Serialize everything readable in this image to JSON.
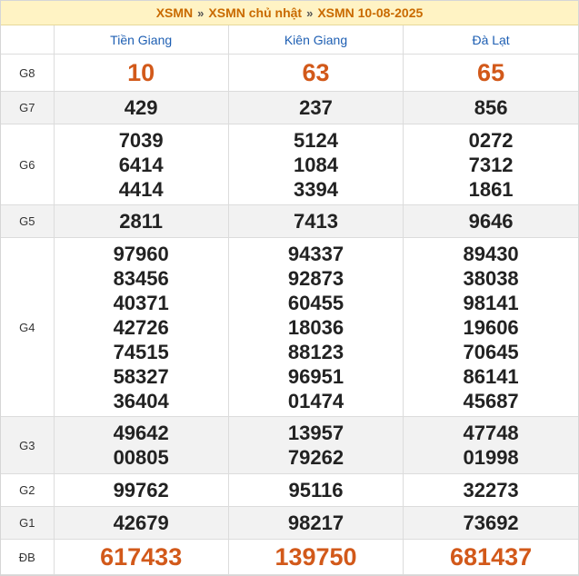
{
  "breadcrumb": {
    "item1": "XSMN",
    "item2": "XSMN chủ nhật",
    "item3": "XSMN 10-08-2025",
    "separator": "»"
  },
  "headers": [
    "Tiền Giang",
    "Kiên Giang",
    "Đà Lạt"
  ],
  "rows": [
    {
      "label": "G8",
      "values": [
        [
          "10"
        ],
        [
          "63"
        ],
        [
          "65"
        ]
      ]
    },
    {
      "label": "G7",
      "values": [
        [
          "429"
        ],
        [
          "237"
        ],
        [
          "856"
        ]
      ]
    },
    {
      "label": "G6",
      "values": [
        [
          "7039",
          "6414",
          "4414"
        ],
        [
          "5124",
          "1084",
          "3394"
        ],
        [
          "0272",
          "7312",
          "1861"
        ]
      ]
    },
    {
      "label": "G5",
      "values": [
        [
          "2811"
        ],
        [
          "7413"
        ],
        [
          "9646"
        ]
      ]
    },
    {
      "label": "G4",
      "values": [
        [
          "97960",
          "83456",
          "40371",
          "42726",
          "74515",
          "58327",
          "36404"
        ],
        [
          "94337",
          "92873",
          "60455",
          "18036",
          "88123",
          "96951",
          "01474"
        ],
        [
          "89430",
          "38038",
          "98141",
          "19606",
          "70645",
          "86141",
          "45687"
        ]
      ]
    },
    {
      "label": "G3",
      "values": [
        [
          "49642",
          "00805"
        ],
        [
          "13957",
          "79262"
        ],
        [
          "47748",
          "01998"
        ]
      ]
    },
    {
      "label": "G2",
      "values": [
        [
          "99762"
        ],
        [
          "95116"
        ],
        [
          "32273"
        ]
      ]
    },
    {
      "label": "G1",
      "values": [
        [
          "42679"
        ],
        [
          "98217"
        ],
        [
          "73692"
        ]
      ]
    },
    {
      "label": "ĐB",
      "values": [
        [
          "617433"
        ],
        [
          "139750"
        ],
        [
          "681437"
        ]
      ]
    }
  ],
  "colors": {
    "accent": "#d2591a",
    "header_text": "#1e5fb3",
    "breadcrumb_bg": "#fff3c4"
  }
}
